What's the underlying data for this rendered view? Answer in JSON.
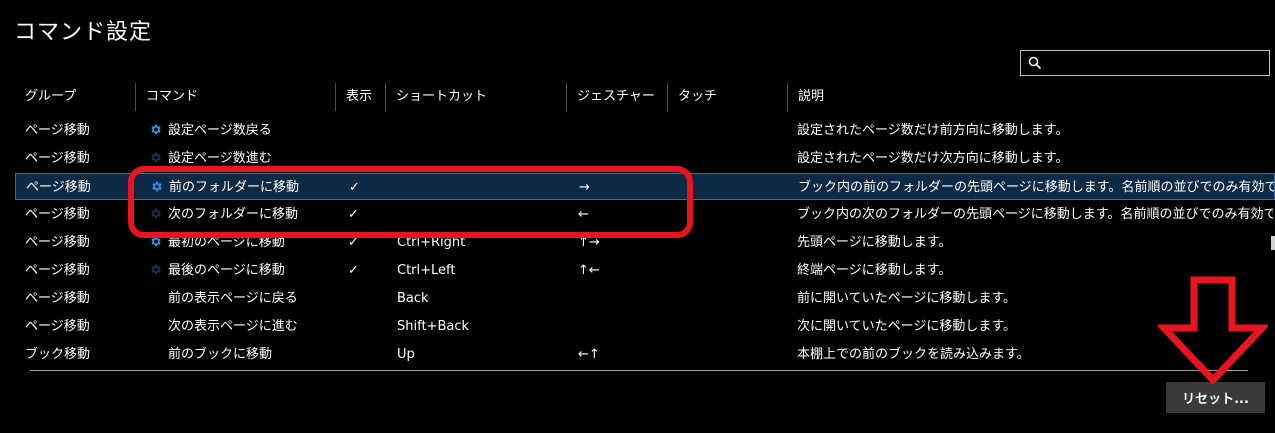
{
  "title": "コマンド設定",
  "search": {
    "placeholder": ""
  },
  "columns": {
    "group": "グループ",
    "command": "コマンド",
    "display": "表示",
    "shortcut": "ショートカット",
    "gesture": "ジェスチャー",
    "touch": "タッチ",
    "description": "説明"
  },
  "rows": [
    {
      "group": "ページ移動",
      "gear": "bright",
      "command": "設定ページ数戻る",
      "display": "",
      "shortcut": "",
      "gesture": "",
      "touch": "",
      "description": "設定されたページ数だけ前方向に移動します。",
      "selected": false
    },
    {
      "group": "ページ移動",
      "gear": "dim",
      "command": "設定ページ数進む",
      "display": "",
      "shortcut": "",
      "gesture": "",
      "touch": "",
      "description": "設定されたページ数だけ次方向に移動します。",
      "selected": false
    },
    {
      "group": "ページ移動",
      "gear": "bright",
      "command": "前のフォルダーに移動",
      "display": "✓",
      "shortcut": "",
      "gesture": "→",
      "touch": "",
      "description": "ブック内の前のフォルダーの先頭ページに移動します。名前順の並びでのみ有効で",
      "selected": true
    },
    {
      "group": "ページ移動",
      "gear": "dim",
      "command": "次のフォルダーに移動",
      "display": "✓",
      "shortcut": "",
      "gesture": "←",
      "touch": "",
      "description": "ブック内の次のフォルダーの先頭ページに移動します。名前順の並びでのみ有効で",
      "selected": false
    },
    {
      "group": "ページ移動",
      "gear": "bright",
      "command": "最初のページに移動",
      "display": "✓",
      "shortcut": "Ctrl+Right",
      "gesture": "↑→",
      "touch": "",
      "description": "先頭ページに移動します。",
      "selected": false
    },
    {
      "group": "ページ移動",
      "gear": "dim",
      "command": "最後のページに移動",
      "display": "✓",
      "shortcut": "Ctrl+Left",
      "gesture": "↑←",
      "touch": "",
      "description": "終端ページに移動します。",
      "selected": false
    },
    {
      "group": "ページ移動",
      "gear": "",
      "command": "前の表示ページに戻る",
      "display": "",
      "shortcut": "Back",
      "gesture": "",
      "touch": "",
      "description": "前に開いていたページに移動します。",
      "selected": false
    },
    {
      "group": "ページ移動",
      "gear": "",
      "command": "次の表示ページに進む",
      "display": "",
      "shortcut": "Shift+Back",
      "gesture": "",
      "touch": "",
      "description": "次に開いていたページに移動します。",
      "selected": false
    },
    {
      "group": "ブック移動",
      "gear": "",
      "command": "前のブックに移動",
      "display": "",
      "shortcut": "Up",
      "gesture": "←↑",
      "touch": "",
      "description": "本棚上での前のブックを読み込みます。",
      "selected": false
    }
  ],
  "reset_button": "リセット...",
  "colors": {
    "background": "#000000",
    "selected_row": "#0c2a45",
    "selected_border": "#2f6fb0",
    "gear_icon": "#3a8ee6",
    "annotation": "#e8141e",
    "reset_bg": "#3a3a3a"
  },
  "icons": {
    "search": "search-icon",
    "gear": "gear-icon"
  }
}
